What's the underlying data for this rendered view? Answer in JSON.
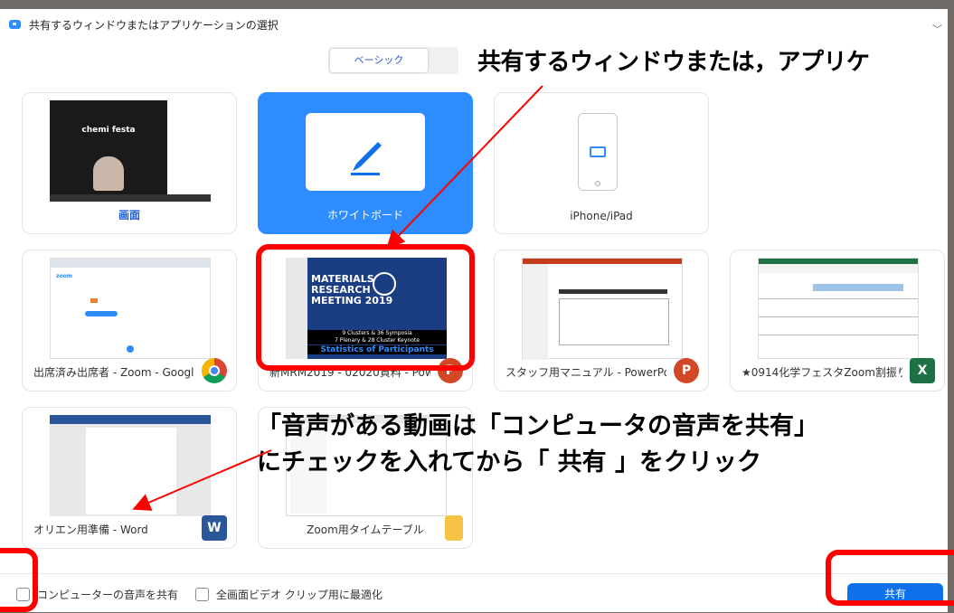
{
  "window": {
    "title": "共有するウィンドウまたはアプリケーションの選択"
  },
  "tabs": {
    "basic": "ベーシック"
  },
  "annotations": {
    "top": "共有するウィンドウまたは，アプリケ",
    "middle_line1": "「音声がある動画は「コンピュータの音声を共有」",
    "middle_line2": "にチェックを入れてから「 共有 」をクリック"
  },
  "cards": [
    {
      "label": "画面",
      "icon": "screen-thumbnail",
      "thumb_text": "chemi festa"
    },
    {
      "label": "ホワイトボード",
      "icon": "pencil-icon",
      "selected": true
    },
    {
      "label": "iPhone/iPad",
      "icon": "airplay-icon"
    },
    {
      "label": "出席済み出席者 - Zoom - Googl...",
      "icon": "chrome-icon"
    },
    {
      "label": "新MRM2019 - 02020資料 - Power...",
      "icon": "powerpoint-icon",
      "thumb_text": [
        "MATERIALS",
        "RESEARCH",
        "MEETING 2019",
        "9 Clusters & 36 Symposia",
        "7 Plenary & 28 Cluster Keynote",
        "Statistics of Participants"
      ]
    },
    {
      "label": "スタッフ用マニュアル - PowerPoint",
      "icon": "powerpoint-icon"
    },
    {
      "label": "★0914化学フェスタZoom割振り - ...",
      "icon": "excel-icon"
    },
    {
      "label": "オリエン用準備 - Word",
      "icon": "word-icon"
    },
    {
      "label": "Zoom用タイムテーブル",
      "icon": "folder-icon"
    }
  ],
  "footer": {
    "share_audio": "コンピューターの音声を共有",
    "optimize_video": "全画面ビデオ クリップ用に最適化",
    "share_button": "共有"
  },
  "colors": {
    "accent": "#2d8cff",
    "annotation": "#ff0000",
    "share_button": "#0e71eb"
  }
}
